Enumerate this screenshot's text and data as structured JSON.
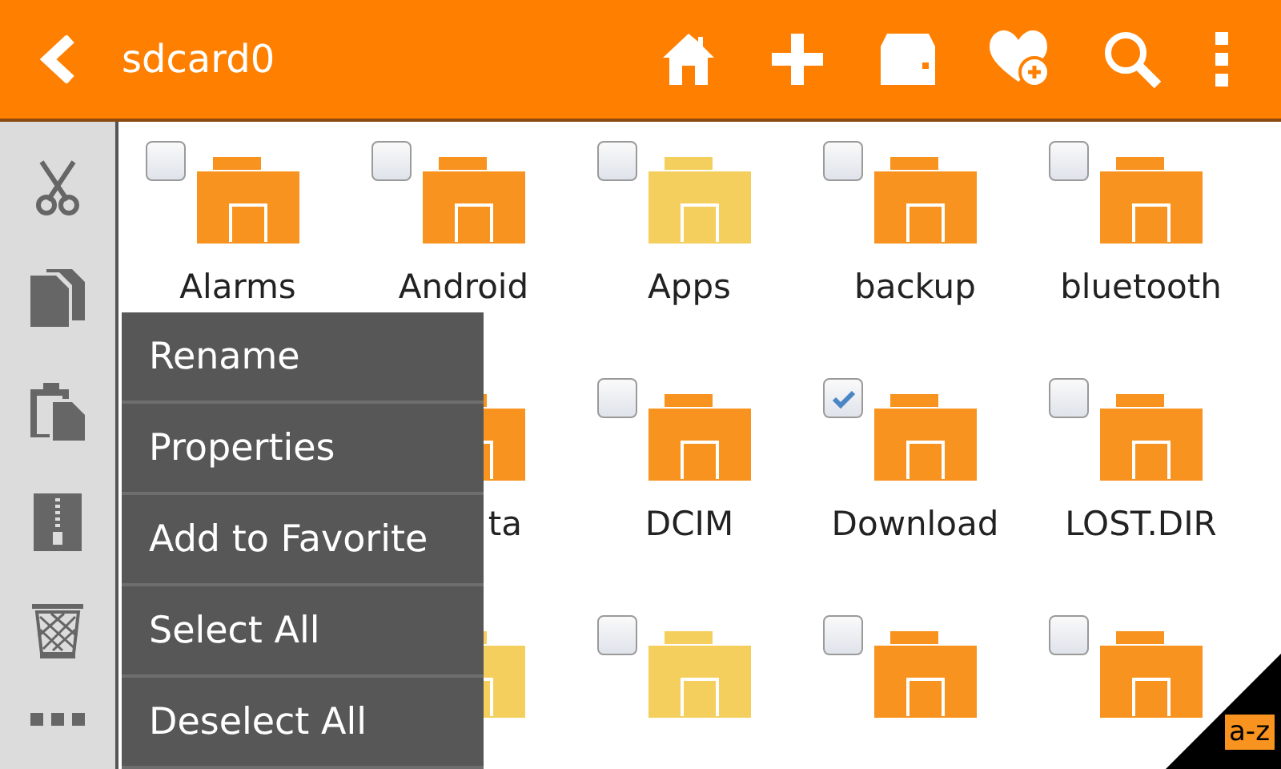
{
  "toolbar": {
    "title": "sdcard0"
  },
  "folders": [
    {
      "kind": "full",
      "label": "Alarms",
      "color": "#f7931e",
      "checked": false
    },
    {
      "kind": "full",
      "label": "Android",
      "color": "#f7931e",
      "checked": false
    },
    {
      "kind": "full",
      "label": "Apps",
      "color": "#f5cf5e",
      "checked": false
    },
    {
      "kind": "full",
      "label": "backup",
      "color": "#f7931e",
      "checked": false
    },
    {
      "kind": "full",
      "label": "bluetooth",
      "color": "#f7931e",
      "checked": false
    },
    {
      "kind": "hidden"
    },
    {
      "kind": "partial",
      "label": "ta",
      "color": "#f7931e"
    },
    {
      "kind": "full",
      "label": "DCIM",
      "color": "#f7931e",
      "checked": false
    },
    {
      "kind": "full",
      "label": "Download",
      "color": "#f7931e",
      "checked": true
    },
    {
      "kind": "full",
      "label": "LOST.DIR",
      "color": "#f7931e",
      "checked": false
    },
    {
      "kind": "hidden"
    },
    {
      "kind": "partial",
      "color": "#f5cf5e"
    },
    {
      "kind": "full",
      "color": "#f5cf5e",
      "checked": false
    },
    {
      "kind": "full",
      "color": "#f7931e",
      "checked": false
    },
    {
      "kind": "full",
      "color": "#f7931e",
      "checked": false
    }
  ],
  "context_menu": [
    "Rename",
    "Properties",
    "Add to Favorite",
    "Select All",
    "Deselect All"
  ],
  "sort_badge": "a-z"
}
